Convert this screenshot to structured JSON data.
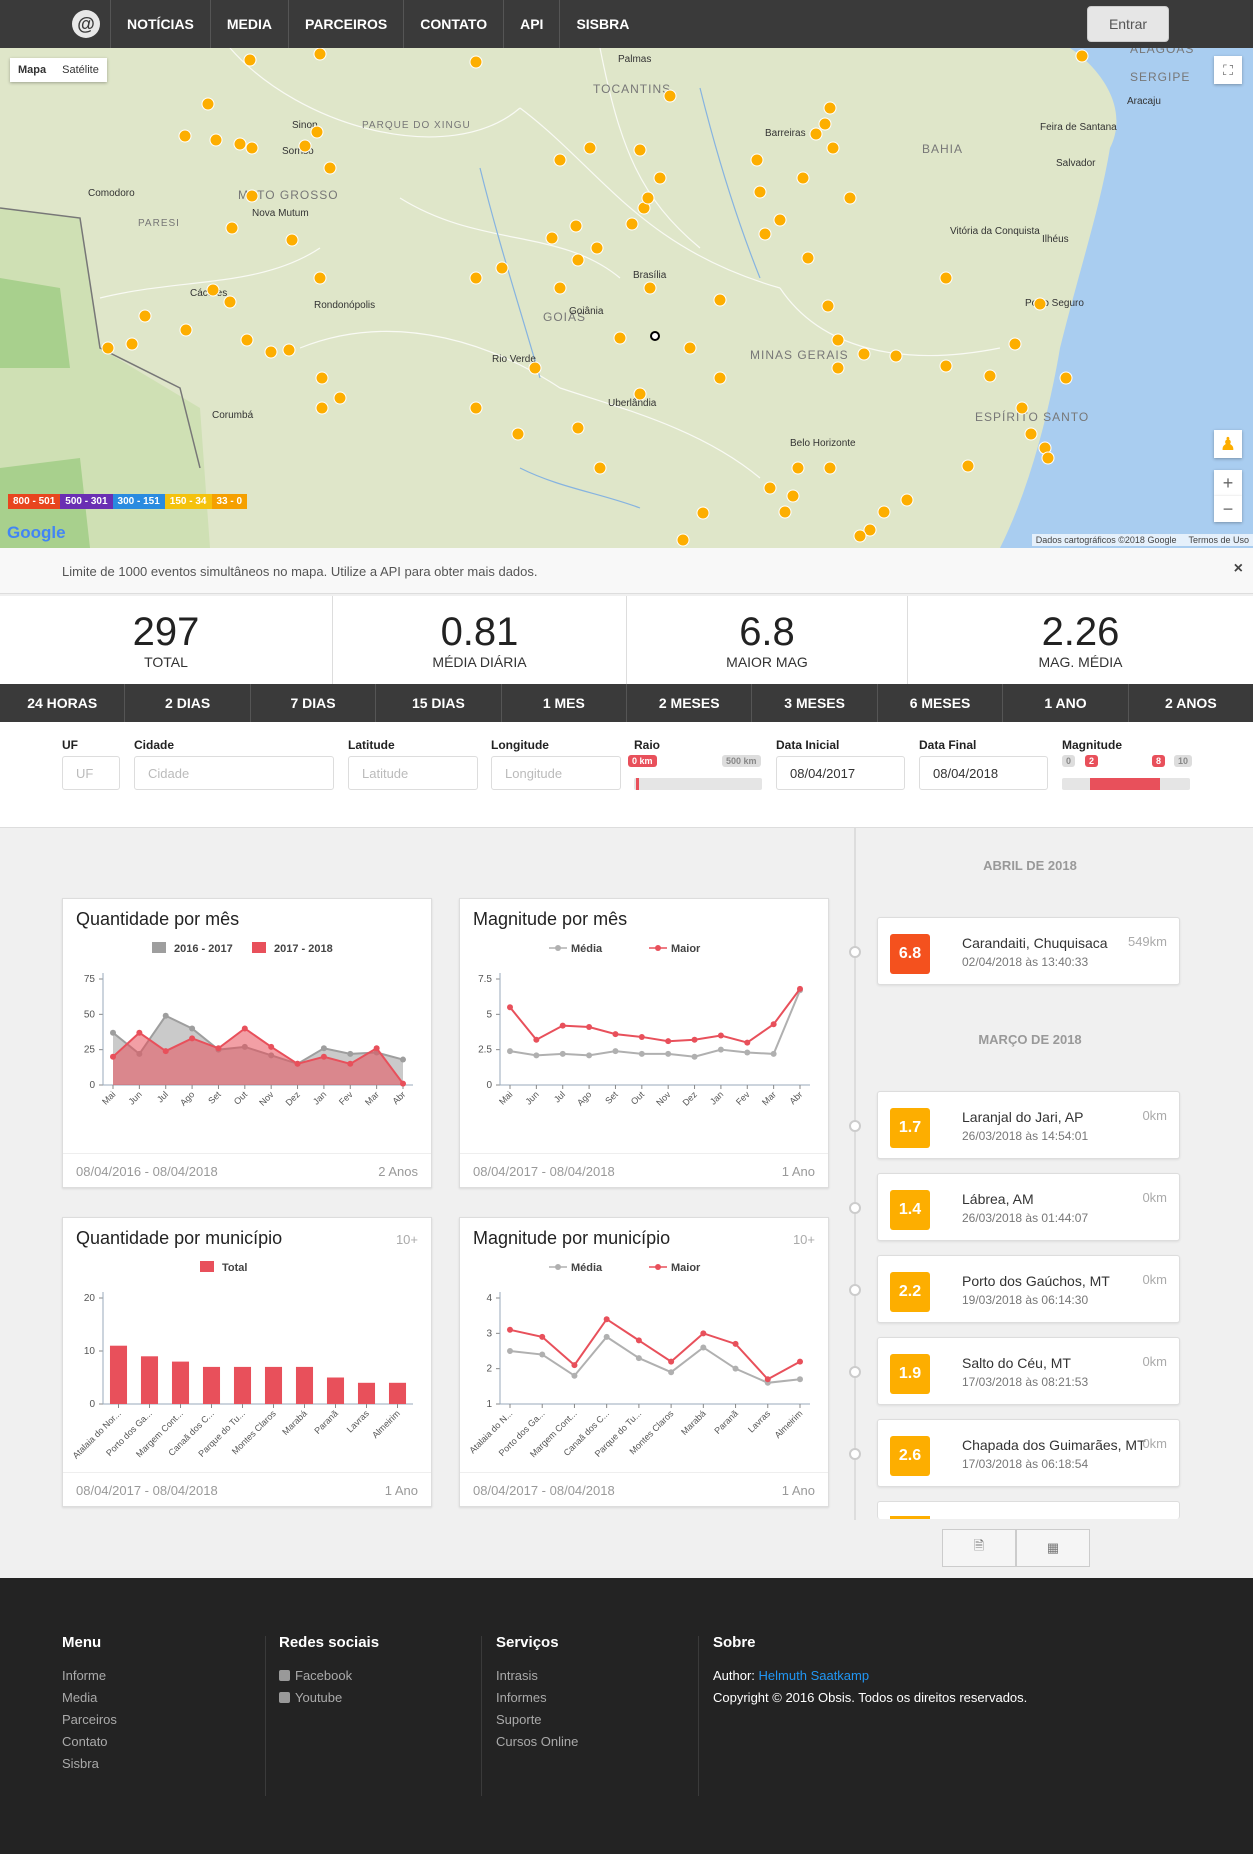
{
  "nav": {
    "logo": "@",
    "items": [
      "NOTÍCIAS",
      "MEDIA",
      "PARCEIROS",
      "CONTATO",
      "API",
      "SISBRA"
    ],
    "login": "Entrar"
  },
  "map": {
    "type_buttons": [
      "Mapa",
      "Satélite"
    ],
    "legend": [
      {
        "label": "800 - 501",
        "color": "#e8451e"
      },
      {
        "label": "500 - 301",
        "color": "#6a2fb3"
      },
      {
        "label": "300 - 151",
        "color": "#2a8be0"
      },
      {
        "label": "150 - 34",
        "color": "#f4c20d"
      },
      {
        "label": "33 - 0",
        "color": "#f5a000"
      }
    ],
    "google": "Google",
    "attribution": "Dados cartográficos ©2018 Google",
    "terms": "Termos de Uso",
    "marker_color": "#fdae00",
    "states": [
      "MATO GROSSO",
      "GOIÁS",
      "MINAS GERAIS",
      "BAHIA",
      "TOCANTINS",
      "SERGIPE",
      "ALAGOAS",
      "ESPÍRITO SANTO",
      "PARQUE DO XINGU",
      "PARESI"
    ],
    "cities": [
      "Sinop",
      "Sorriso",
      "Cáceres",
      "Rondonópolis",
      "Rio Verde",
      "Goiânia",
      "Brasília",
      "Uberlândia",
      "Belo Horizonte",
      "Salvador",
      "Vitória da Conquista",
      "Ilhéus",
      "Porto Seguro",
      "Barreiras",
      "Palmas",
      "Aracaju",
      "Corumbá",
      "Comodoro",
      "Nova Mutum",
      "Feira de Santana"
    ]
  },
  "notice": {
    "text": "Limite de 1000 eventos simultâneos no mapa. Utilize a API para obter mais dados.",
    "close": "×"
  },
  "stats": [
    {
      "value": "297",
      "label": "TOTAL"
    },
    {
      "value": "0.81",
      "label": "MÉDIA DIÁRIA"
    },
    {
      "value": "6.8",
      "label": "MAIOR MAG"
    },
    {
      "value": "2.26",
      "label": "MAG. MÉDIA"
    }
  ],
  "periods": [
    "24 HORAS",
    "2 DIAS",
    "7 DIAS",
    "15 DIAS",
    "1 MES",
    "2 MESES",
    "3 MESES",
    "6 MESES",
    "1 ANO",
    "2 ANOS"
  ],
  "filters": {
    "uf": {
      "label": "UF",
      "placeholder": "UF"
    },
    "cidade": {
      "label": "Cidade",
      "placeholder": "Cidade"
    },
    "latitude": {
      "label": "Latitude",
      "placeholder": "Latitude"
    },
    "longitude": {
      "label": "Longitude",
      "placeholder": "Longitude"
    },
    "raio": {
      "label": "Raio",
      "min_label": "0 km",
      "max_label": "500 km",
      "value": 0,
      "max": 500
    },
    "data_inicial": {
      "label": "Data Inicial",
      "value": "08/04/2017"
    },
    "data_final": {
      "label": "Data Final",
      "value": "08/04/2018"
    },
    "magnitude": {
      "label": "Magnitude",
      "min": "0",
      "low": "2",
      "high": "8",
      "max": "10"
    }
  },
  "cards": {
    "qtd_mes": {
      "title": "Quantidade por mês",
      "range": "08/04/2016 - 08/04/2018",
      "period": "2 Anos"
    },
    "mag_mes": {
      "title": "Magnitude por mês",
      "range": "08/04/2017 - 08/04/2018",
      "period": "1 Ano"
    },
    "qtd_mun": {
      "title": "Quantidade por município",
      "count": "10+",
      "range": "08/04/2017 - 08/04/2018",
      "period": "1 Ano"
    },
    "mag_mun": {
      "title": "Magnitude por município",
      "count": "10+",
      "range": "08/04/2017 - 08/04/2018",
      "period": "1 Ano"
    }
  },
  "chart_data": [
    {
      "id": "qtd_mes",
      "type": "area",
      "categories": [
        "Mai",
        "Jun",
        "Jul",
        "Ago",
        "Set",
        "Out",
        "Nov",
        "Dez",
        "Jan",
        "Fev",
        "Mar",
        "Abr"
      ],
      "ylim": [
        0,
        75
      ],
      "yticks": [
        0,
        25,
        50,
        75
      ],
      "series": [
        {
          "name": "2016 - 2017",
          "color": "#9e9e9e",
          "values": [
            37,
            22,
            49,
            40,
            25,
            27,
            21,
            15,
            26,
            22,
            23,
            18
          ]
        },
        {
          "name": "2017 - 2018",
          "color": "#e8505b",
          "values": [
            20,
            37,
            24,
            33,
            26,
            40,
            27,
            15,
            20,
            15,
            26,
            1
          ]
        }
      ]
    },
    {
      "id": "mag_mes",
      "type": "line",
      "categories": [
        "Mai",
        "Jun",
        "Jul",
        "Ago",
        "Set",
        "Out",
        "Nov",
        "Dez",
        "Jan",
        "Fev",
        "Mar",
        "Abr"
      ],
      "ylim": [
        0,
        7.5
      ],
      "yticks": [
        0,
        2.5,
        5,
        7.5
      ],
      "series": [
        {
          "name": "Média",
          "color": "#b0b0b0",
          "values": [
            2.4,
            2.1,
            2.2,
            2.1,
            2.4,
            2.2,
            2.2,
            2.0,
            2.5,
            2.3,
            2.2,
            6.7
          ]
        },
        {
          "name": "Maior",
          "color": "#e8505b",
          "values": [
            5.5,
            3.2,
            4.2,
            4.1,
            3.6,
            3.4,
            3.1,
            3.2,
            3.5,
            3.0,
            4.3,
            6.8
          ]
        }
      ]
    },
    {
      "id": "qtd_mun",
      "type": "bar",
      "categories": [
        "Atalaia do Nor...",
        "Porto dos Ga...",
        "Margem Cont...",
        "Canaã dos C...",
        "Parque do Tu...",
        "Montes Claros",
        "Marabá",
        "Paranã",
        "Lavras",
        "Almeirim"
      ],
      "ylim": [
        0,
        20
      ],
      "yticks": [
        0,
        10,
        20
      ],
      "series": [
        {
          "name": "Total",
          "color": "#e8505b",
          "values": [
            11,
            9,
            8,
            7,
            7,
            7,
            7,
            5,
            4,
            4
          ]
        }
      ]
    },
    {
      "id": "mag_mun",
      "type": "line",
      "categories": [
        "Atalaia do N...",
        "Porto dos Ga...",
        "Margem Cont...",
        "Canaã dos C...",
        "Parque do Tu...",
        "Montes Claros",
        "Marabá",
        "Paranã",
        "Lavras",
        "Almeirim"
      ],
      "ylim": [
        1,
        4
      ],
      "yticks": [
        1,
        2,
        3,
        4
      ],
      "series": [
        {
          "name": "Média",
          "color": "#b0b0b0",
          "values": [
            2.5,
            2.4,
            1.8,
            2.9,
            2.3,
            1.9,
            2.6,
            2.0,
            1.6,
            1.7
          ]
        },
        {
          "name": "Maior",
          "color": "#e8505b",
          "values": [
            3.1,
            2.9,
            2.1,
            3.4,
            2.8,
            2.2,
            3.0,
            2.7,
            1.7,
            2.2
          ]
        }
      ]
    }
  ],
  "timeline": {
    "months": [
      "ABRIL DE 2018",
      "MARÇO DE 2018"
    ],
    "events": [
      {
        "mag": "6.8",
        "color": "#f4511e",
        "place": "Carandaiti, Chuquisaca",
        "time": "02/04/2018 às 13:40:33",
        "dist": "549km"
      },
      {
        "mag": "1.7",
        "color": "#fdae00",
        "place": "Laranjal do Jari, AP",
        "time": "26/03/2018 às 14:54:01",
        "dist": "0km"
      },
      {
        "mag": "1.4",
        "color": "#fdae00",
        "place": "Lábrea, AM",
        "time": "26/03/2018 às 01:44:07",
        "dist": "0km"
      },
      {
        "mag": "2.2",
        "color": "#fdae00",
        "place": "Porto dos Gaúchos, MT",
        "time": "19/03/2018 às 06:14:30",
        "dist": "0km"
      },
      {
        "mag": "1.9",
        "color": "#fdae00",
        "place": "Salto do Céu, MT",
        "time": "17/03/2018 às 08:21:53",
        "dist": "0km"
      },
      {
        "mag": "2.6",
        "color": "#fdae00",
        "place": "Chapada dos Guimarães, MT",
        "time": "17/03/2018 às 06:18:54",
        "dist": "0km"
      }
    ]
  },
  "footer": {
    "menu": {
      "title": "Menu",
      "items": [
        "Informe",
        "Media",
        "Parceiros",
        "Contato",
        "Sisbra"
      ]
    },
    "social": {
      "title": "Redes sociais",
      "items": [
        "Facebook",
        "Youtube"
      ]
    },
    "services": {
      "title": "Serviços",
      "items": [
        "Intrasis",
        "Informes",
        "Suporte",
        "Cursos Online"
      ]
    },
    "about": {
      "title": "Sobre",
      "author_label": "Author:",
      "author": "Helmuth Saatkamp",
      "copyright": "Copyright © 2016 Obsis. Todos os direitos reservados."
    }
  }
}
